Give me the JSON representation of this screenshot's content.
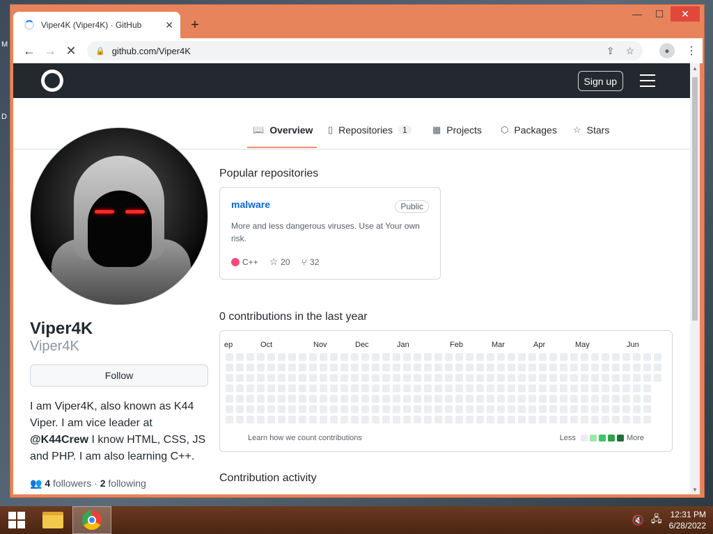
{
  "desktop": {
    "label_m": "M",
    "label_d": "D"
  },
  "browser": {
    "tab_title": "Viper4K (Viper4K) · GitHub",
    "tab_close": "✕",
    "new_tab": "+",
    "url": "github.com/Viper4K",
    "back": "←",
    "forward": "→",
    "reload": "✕",
    "controls": {
      "minimize": "—",
      "maximize": "☐",
      "close": "✕"
    }
  },
  "header": {
    "signup": "Sign up"
  },
  "tabs": [
    {
      "label": "Overview",
      "icon": "book-icon"
    },
    {
      "label": "Repositories",
      "icon": "repo-icon",
      "count": "1"
    },
    {
      "label": "Projects",
      "icon": "table-icon"
    },
    {
      "label": "Packages",
      "icon": "package-icon"
    },
    {
      "label": "Stars",
      "icon": "star-icon"
    }
  ],
  "profile": {
    "name": "Viper4K",
    "login": "Viper4K",
    "follow": "Follow",
    "bio_pre": "I am Viper4K, also known as K44 Viper. I am vice leader at ",
    "bio_mention": "@K44Crew",
    "bio_post": " I know HTML, CSS, JS and PHP. I am also learning C++.",
    "followers_count": "4",
    "followers_label": "followers",
    "sep": "·",
    "following_count": "2",
    "following_label": "following"
  },
  "popular": {
    "title": "Popular repositories",
    "repo": {
      "name": "malware",
      "badge": "Public",
      "desc": "More and less dangerous viruses. Use at Your own risk.",
      "lang": "C++",
      "lang_color": "#f34b7d",
      "stars": "20",
      "forks": "32"
    }
  },
  "contributions": {
    "title": "0 contributions in the last year",
    "months": [
      "ep",
      "Oct",
      "Nov",
      "Dec",
      "Jan",
      "Feb",
      "Mar",
      "Apr",
      "May",
      "Jun"
    ],
    "learn": "Learn how we count contributions",
    "less": "Less",
    "more": "More",
    "legend_colors": [
      "#ebedf0",
      "#9be9a8",
      "#40c463",
      "#30a14e",
      "#216e39"
    ]
  },
  "activity": {
    "title": "Contribution activity"
  },
  "taskbar": {
    "time": "12:31 PM",
    "date": "6/28/2022"
  }
}
